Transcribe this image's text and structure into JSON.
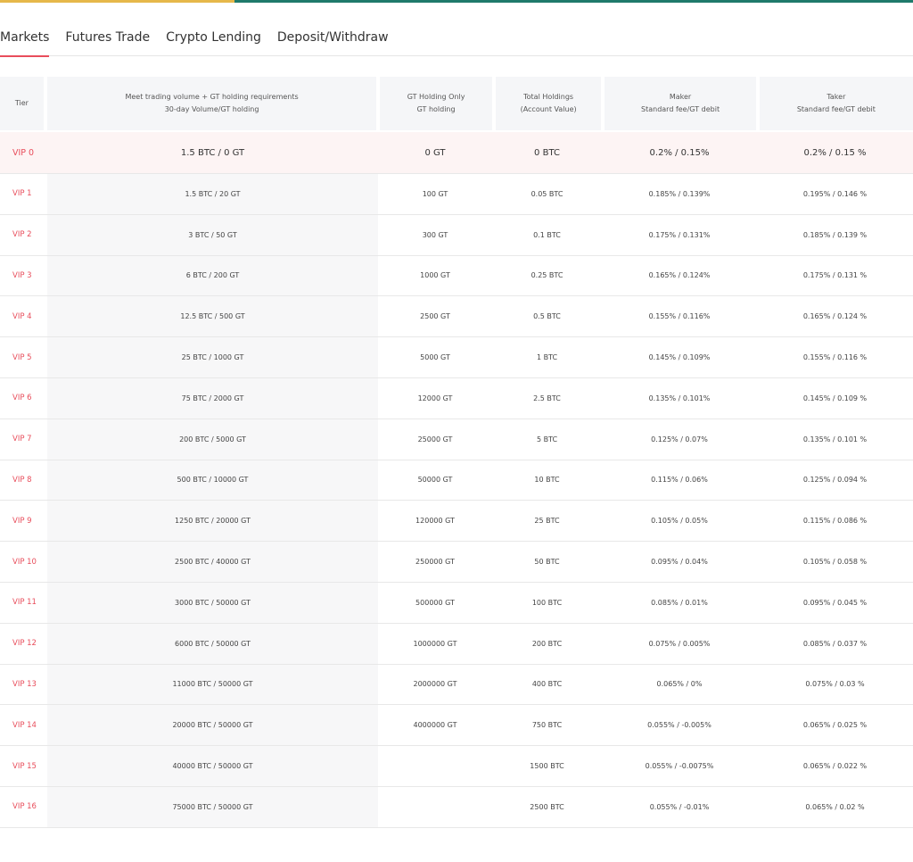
{
  "colors": {
    "accent": "#e84d5b",
    "top_bar_left": "#e6b84a",
    "top_bar_right": "#1f7a6b"
  },
  "tabs": [
    "Markets",
    "Futures Trade",
    "Crypto Lending",
    "Deposit/Withdraw"
  ],
  "headers": {
    "tier": "Tier",
    "volume_line1": "Meet trading volume + GT holding requirements",
    "volume_line2": "30-day Volume/GT holding",
    "gt_line1": "GT Holding Only",
    "gt_line2": "GT holding",
    "total_line1": "Total Holdings",
    "total_line2": "(Account Value)",
    "maker_line1": "Maker",
    "maker_line2": "Standard fee/GT debit",
    "taker_line1": "Taker",
    "taker_line2": "Standard fee/GT debit"
  },
  "rows": [
    [
      "VIP 0",
      "1.5 BTC / 0 GT",
      "0 GT",
      "0 BTC",
      "0.2% / 0.15%",
      "0.2% / 0.15 %"
    ],
    [
      "VIP 1",
      "1.5 BTC / 20 GT",
      "100 GT",
      "0.05 BTC",
      "0.185% / 0.139%",
      "0.195% / 0.146 %"
    ],
    [
      "VIP 2",
      "3 BTC / 50 GT",
      "300 GT",
      "0.1 BTC",
      "0.175% / 0.131%",
      "0.185% / 0.139 %"
    ],
    [
      "VIP 3",
      "6 BTC / 200 GT",
      "1000 GT",
      "0.25 BTC",
      "0.165% / 0.124%",
      "0.175% / 0.131 %"
    ],
    [
      "VIP 4",
      "12.5 BTC / 500 GT",
      "2500 GT",
      "0.5 BTC",
      "0.155% / 0.116%",
      "0.165% / 0.124 %"
    ],
    [
      "VIP 5",
      "25 BTC / 1000 GT",
      "5000 GT",
      "1 BTC",
      "0.145% / 0.109%",
      "0.155% / 0.116 %"
    ],
    [
      "VIP 6",
      "75 BTC / 2000 GT",
      "12000 GT",
      "2.5 BTC",
      "0.135% / 0.101%",
      "0.145% / 0.109 %"
    ],
    [
      "VIP 7",
      "200 BTC / 5000 GT",
      "25000 GT",
      "5 BTC",
      "0.125% / 0.07%",
      "0.135% / 0.101 %"
    ],
    [
      "VIP 8",
      "500 BTC / 10000 GT",
      "50000 GT",
      "10 BTC",
      "0.115% / 0.06%",
      "0.125% / 0.094 %"
    ],
    [
      "VIP 9",
      "1250 BTC / 20000 GT",
      "120000 GT",
      "25 BTC",
      "0.105% / 0.05%",
      "0.115% / 0.086 %"
    ],
    [
      "VIP 10",
      "2500 BTC / 40000 GT",
      "250000 GT",
      "50 BTC",
      "0.095% / 0.04%",
      "0.105% / 0.058 %"
    ],
    [
      "VIP 11",
      "3000 BTC / 50000 GT",
      "500000 GT",
      "100 BTC",
      "0.085% / 0.01%",
      "0.095% / 0.045 %"
    ],
    [
      "VIP 12",
      "6000 BTC / 50000 GT",
      "1000000 GT",
      "200 BTC",
      "0.075% / 0.005%",
      "0.085% / 0.037 %"
    ],
    [
      "VIP 13",
      "11000 BTC / 50000 GT",
      "2000000 GT",
      "400 BTC",
      "0.065% / 0%",
      "0.075% / 0.03 %"
    ],
    [
      "VIP 14",
      "20000 BTC / 50000 GT",
      "4000000 GT",
      "750 BTC",
      "0.055% / -0.005%",
      "0.065% / 0.025 %"
    ],
    [
      "VIP 15",
      "40000 BTC / 50000 GT",
      "",
      "1500 BTC",
      "0.055% / -0.0075%",
      "0.065% / 0.022 %"
    ],
    [
      "VIP 16",
      "75000 BTC / 50000 GT",
      "",
      "2500 BTC",
      "0.055% / -0.01%",
      "0.065% / 0.02 %"
    ]
  ]
}
